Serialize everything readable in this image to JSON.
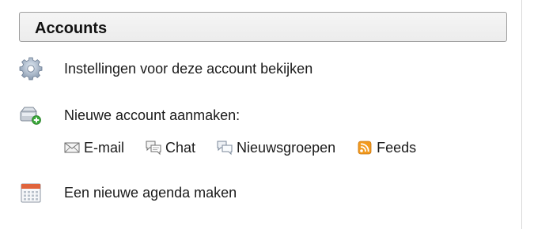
{
  "header": {
    "title": "Accounts"
  },
  "actions": {
    "view_settings": "Instellingen voor deze account bekijken",
    "create_account": "Nieuwe account aanmaken:",
    "new_calendar": "Een nieuwe agenda maken"
  },
  "account_types": [
    {
      "label": "E-mail",
      "icon": "envelope-icon"
    },
    {
      "label": "Chat",
      "icon": "chat-bubbles-icon"
    },
    {
      "label": "Nieuwsgroepen",
      "icon": "newsgroup-bubbles-icon"
    },
    {
      "label": "Feeds",
      "icon": "rss-feed-icon"
    }
  ],
  "colors": {
    "header_border": "#9e9e9e",
    "header_bg": "#efefef",
    "feed_orange": "#f29a1e",
    "add_green": "#3aa83a",
    "calendar_red": "#e0643c"
  }
}
